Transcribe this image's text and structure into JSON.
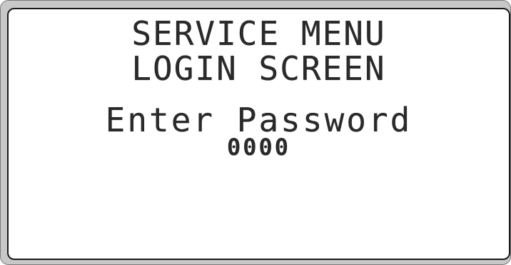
{
  "screen": {
    "title_line1": "SERVICE MENU",
    "title_line2": "LOGIN SCREEN",
    "prompt": "Enter Password",
    "password_value": "0000"
  },
  "colors": {
    "text": "#2a2a2a",
    "background": "#ffffff",
    "bezel": "#c8c8c8"
  }
}
